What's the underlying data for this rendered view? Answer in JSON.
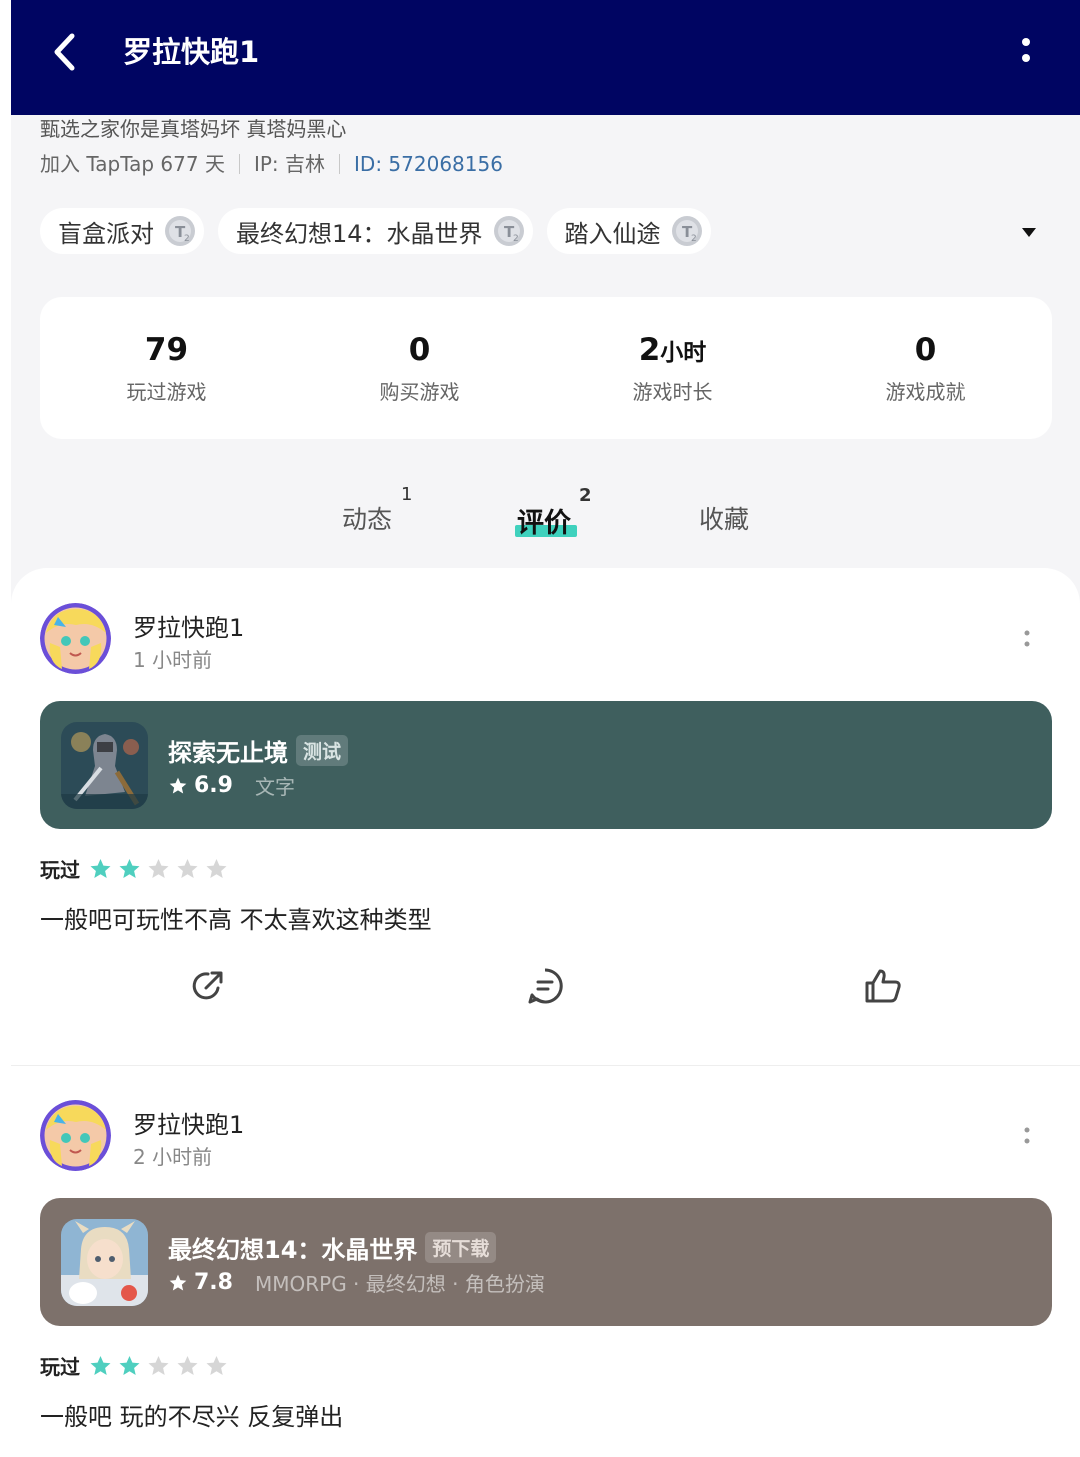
{
  "header": {
    "title": "罗拉快跑1"
  },
  "profile": {
    "bio": "甄选之家你是真塔妈坏 真塔妈黑心",
    "joined": "加入 TapTap 677 天",
    "ip": "IP: 吉林",
    "uid": "ID: 572068156"
  },
  "tags": [
    "盲盒派对",
    "最终幻想14：水晶世界",
    "踏入仙途"
  ],
  "stats": [
    {
      "value": "79",
      "unit": "",
      "label": "玩过游戏"
    },
    {
      "value": "0",
      "unit": "",
      "label": "购买游戏"
    },
    {
      "value": "2",
      "unit": "小时",
      "label": "游戏时长"
    },
    {
      "value": "0",
      "unit": "",
      "label": "游戏成就"
    }
  ],
  "tabs": [
    {
      "label": "动态",
      "count": "1"
    },
    {
      "label": "评价",
      "count": "2"
    },
    {
      "label": "收藏",
      "count": ""
    }
  ],
  "posts": [
    {
      "user": "罗拉快跑1",
      "time": "1 小时前",
      "game": {
        "name": "探索无止境",
        "badge": "测试",
        "rating": "6.9",
        "genres": "文字",
        "card_color": "#3f5f5e"
      },
      "played_label": "玩过",
      "stars": 2,
      "text": "一般吧可玩性不高 不太喜欢这种类型"
    },
    {
      "user": "罗拉快跑1",
      "time": "2 小时前",
      "game": {
        "name": "最终幻想14：水晶世界",
        "badge": "预下载",
        "rating": "7.8",
        "genres": "MMORPG · 最终幻想 · 角色扮演",
        "card_color": "#7d716b"
      },
      "played_label": "玩过",
      "stars": 2,
      "text": "一般吧 玩的不尽兴 反复弹出"
    }
  ],
  "colors": {
    "header_bg": "#000562",
    "accent": "#3fd1bd",
    "star_on": "#4fcfbf",
    "star_off": "#d6d6d6"
  }
}
